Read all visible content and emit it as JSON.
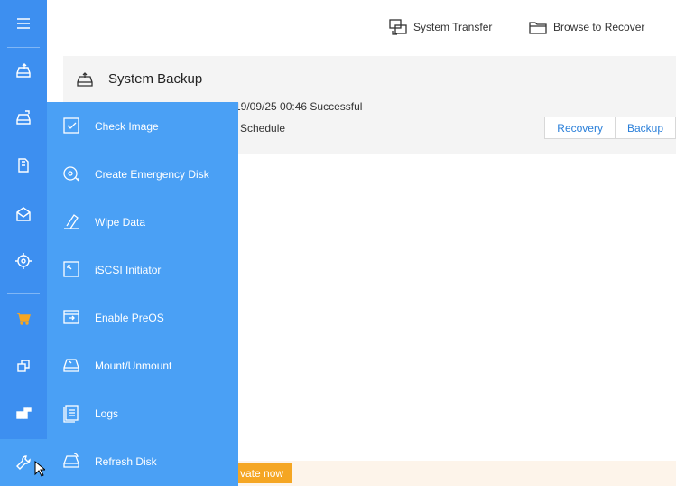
{
  "rail": {
    "items": [
      {
        "name": "menu-icon",
        "active": false
      },
      {
        "name": "backup-drive-icon",
        "active": false
      },
      {
        "name": "clone-drive-icon",
        "active": false
      },
      {
        "name": "files-icon",
        "active": false
      },
      {
        "name": "mail-icon",
        "active": false
      },
      {
        "name": "target-icon",
        "active": false
      },
      {
        "name": "cart-icon",
        "active": false
      },
      {
        "name": "copy-icon",
        "active": false
      },
      {
        "name": "apps-icon",
        "active": false
      },
      {
        "name": "wrench-icon",
        "active": true
      }
    ]
  },
  "topbar": {
    "system_transfer": "System Transfer",
    "browse_to_recover": "Browse to Recover"
  },
  "card": {
    "title": "System Backup",
    "status": "19/09/25 00:46 Successful",
    "schedule": "Schedule",
    "recovery_label": "Recovery",
    "backup_label": "Backup"
  },
  "banner": {
    "activate_label": "vate now"
  },
  "tools_menu": {
    "items": [
      {
        "label": "Check Image",
        "icon": "check-image-icon"
      },
      {
        "label": "Create Emergency Disk",
        "icon": "emergency-disk-icon"
      },
      {
        "label": "Wipe Data",
        "icon": "eraser-icon"
      },
      {
        "label": "iSCSI Initiator",
        "icon": "iscsi-icon"
      },
      {
        "label": "Enable PreOS",
        "icon": "preos-icon"
      },
      {
        "label": "Mount/Unmount",
        "icon": "mount-icon"
      },
      {
        "label": "Logs",
        "icon": "logs-icon"
      },
      {
        "label": "Refresh Disk",
        "icon": "refresh-disk-icon"
      }
    ]
  },
  "colors": {
    "rail": "#3d8ff0",
    "flyout": "#4aa0f5",
    "accent_text": "#2a7fd9",
    "activate": "#f5a623"
  }
}
